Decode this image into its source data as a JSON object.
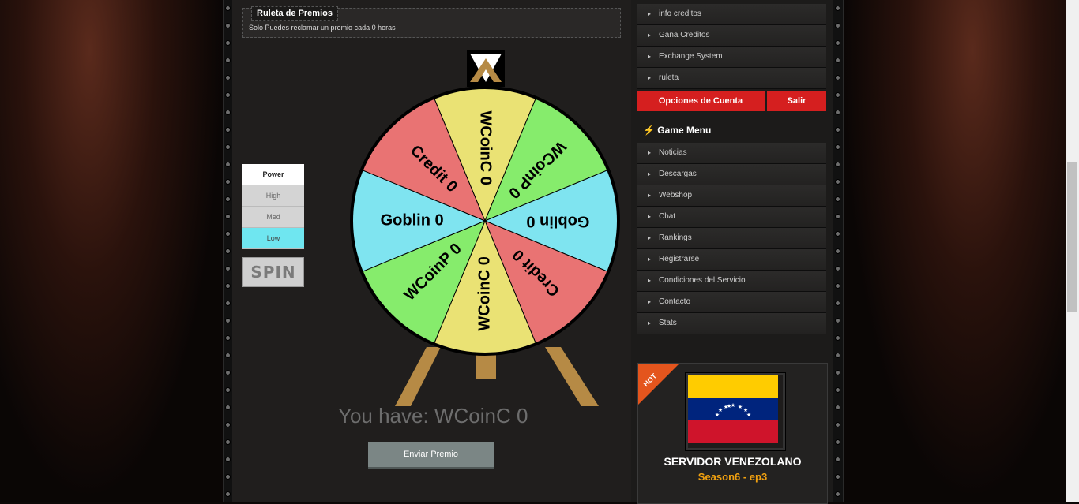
{
  "header": {
    "title": "Ruleta de Premios",
    "notice": "Solo Puedes reclamar un premio cada 0 horas"
  },
  "power": {
    "title": "Power",
    "options": [
      "High",
      "Med",
      "Low"
    ],
    "selected": "Low"
  },
  "spin_label": "SPIN",
  "wheel": {
    "segments": [
      {
        "label": "WCoinC 0",
        "color": "#eae274"
      },
      {
        "label": "WCoinP 0",
        "color": "#86ec6c"
      },
      {
        "label": "Goblin 0",
        "color": "#7fe4f0"
      },
      {
        "label": "Credit 0",
        "color": "#e97373"
      },
      {
        "label": "WCoinC 0",
        "color": "#eae274"
      },
      {
        "label": "WCoinP 0",
        "color": "#86ec6c"
      },
      {
        "label": "Goblin 0",
        "color": "#7fe4f0"
      },
      {
        "label": "Credit 0",
        "color": "#e97373"
      }
    ]
  },
  "result_text": "You have: WCoinC 0",
  "send_button": "Enviar Premio",
  "account_menu": {
    "items": [
      "info creditos",
      "Gana Creditos",
      "Exchange System",
      "ruleta"
    ],
    "options_button": "Opciones de Cuenta",
    "logout_button": "Salir"
  },
  "game_menu": {
    "title": "Game Menu",
    "items": [
      "Noticias",
      "Descargas",
      "Webshop",
      "Chat",
      "Rankings",
      "Registrarse",
      "Condiciones del Servicio",
      "Contacto",
      "Stats"
    ]
  },
  "banner": {
    "badge": "HOT",
    "title": "SERVIDOR VENEZOLANO",
    "subtitle": "Season6 - ep3"
  },
  "colors": {
    "accent_red": "#d51f1f",
    "power_selected": "#6fe6f0",
    "banner_sub": "#f0a010"
  }
}
